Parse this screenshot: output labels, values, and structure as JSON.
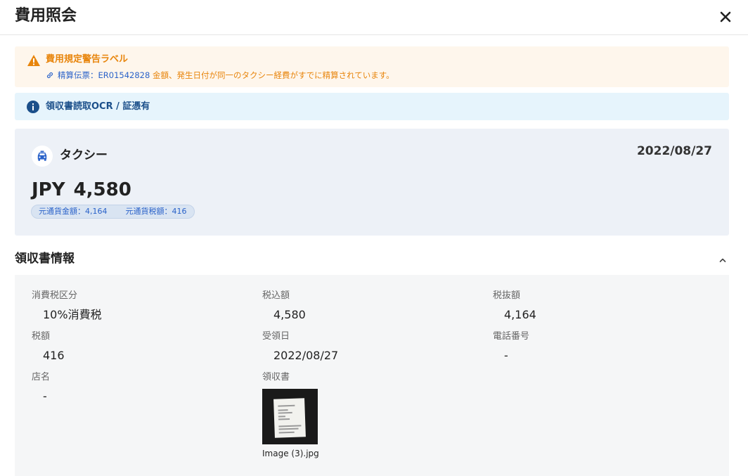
{
  "header": {
    "title": "費用照会",
    "close_icon": "close-icon"
  },
  "warning": {
    "title": "費用規定警告ラベル",
    "ref_label": "精算伝票：ER01542828",
    "message": " 金額、発生日付が同一のタクシー経費がすでに精算されています。",
    "color": "#e8850c"
  },
  "info": {
    "text": "領収書読取OCR / 証憑有",
    "color": "#1b4f8a"
  },
  "summary": {
    "category": "タクシー",
    "category_icon": "taxi-icon",
    "date": "2022/08/27",
    "currency": "JPY",
    "amount": "4,580",
    "base_amount": "元通貨金額：4,164",
    "base_tax": "元通貨税額：416"
  },
  "receipt_section": {
    "title": "領収書情報",
    "fields": {
      "tax_category": {
        "label": "消費税区分",
        "value": "10%消費税"
      },
      "tax_included": {
        "label": "税込額",
        "value": "4,580"
      },
      "tax_excluded": {
        "label": "税抜額",
        "value": "4,164"
      },
      "tax_amount": {
        "label": "税額",
        "value": "416"
      },
      "receipt_date": {
        "label": "受領日",
        "value": "2022/08/27"
      },
      "phone": {
        "label": "電話番号",
        "value": "-"
      },
      "store": {
        "label": "店名",
        "value": "-"
      },
      "receipt": {
        "label": "領収書",
        "file_name": "Image (3).jpg"
      }
    }
  }
}
